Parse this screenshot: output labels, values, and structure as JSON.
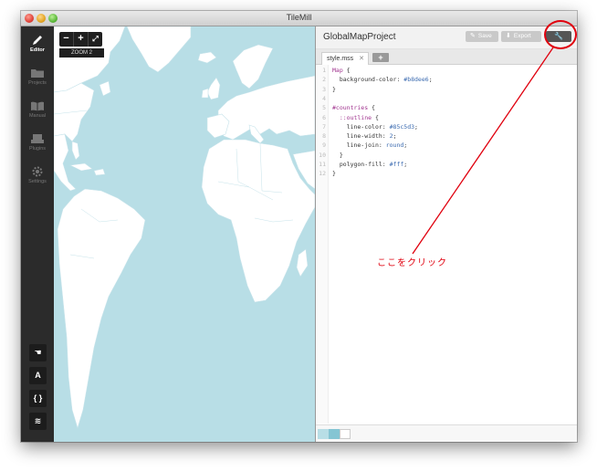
{
  "window": {
    "title": "TileMill"
  },
  "sidebar": {
    "items": [
      {
        "label": "Editor",
        "icon": "pencil-icon"
      },
      {
        "label": "Projects",
        "icon": "folder-icon"
      },
      {
        "label": "Manual",
        "icon": "book-icon"
      },
      {
        "label": "Plugins",
        "icon": "plug-icon"
      },
      {
        "label": "Settings",
        "icon": "gear-icon"
      }
    ],
    "tools": [
      {
        "glyph": "☚",
        "icon": "hand-icon"
      },
      {
        "glyph": "A",
        "icon": "font-icon"
      },
      {
        "glyph": "{ }",
        "icon": "braces-icon"
      },
      {
        "glyph": "≋",
        "icon": "layers-icon"
      }
    ]
  },
  "map": {
    "zoom_out": "−",
    "zoom_in": "+",
    "fullscreen": "⤢",
    "zoom_label": "ZOOM 2",
    "ocean_color": "#b8dee6",
    "land_color": "#ffffff"
  },
  "editor": {
    "project_title": "GlobalMapProject",
    "save_label": "Save",
    "export_label": "Export",
    "wrench_glyph": "🔧",
    "tab_label": "style.mss",
    "tab_close": "✕",
    "add_tab": "+",
    "code_lines": [
      {
        "n": "1",
        "text": "Map {"
      },
      {
        "n": "2",
        "text": "  background-color: #b8dee6;"
      },
      {
        "n": "3",
        "text": "}"
      },
      {
        "n": "4",
        "text": ""
      },
      {
        "n": "5",
        "text": "#countries {"
      },
      {
        "n": "6",
        "text": "  ::outline {"
      },
      {
        "n": "7",
        "text": "    line-color: #85c5d3;"
      },
      {
        "n": "8",
        "text": "    line-width: 2;"
      },
      {
        "n": "9",
        "text": "    line-join: round;"
      },
      {
        "n": "10",
        "text": "  }"
      },
      {
        "n": "11",
        "text": "  polygon-fill: #fff;"
      },
      {
        "n": "12",
        "text": "}"
      }
    ],
    "swatches": [
      "#b8dee6",
      "#85c5d3",
      "#ffffff"
    ]
  },
  "annotation": {
    "text": "ここをクリック",
    "color": "#e0000e"
  }
}
